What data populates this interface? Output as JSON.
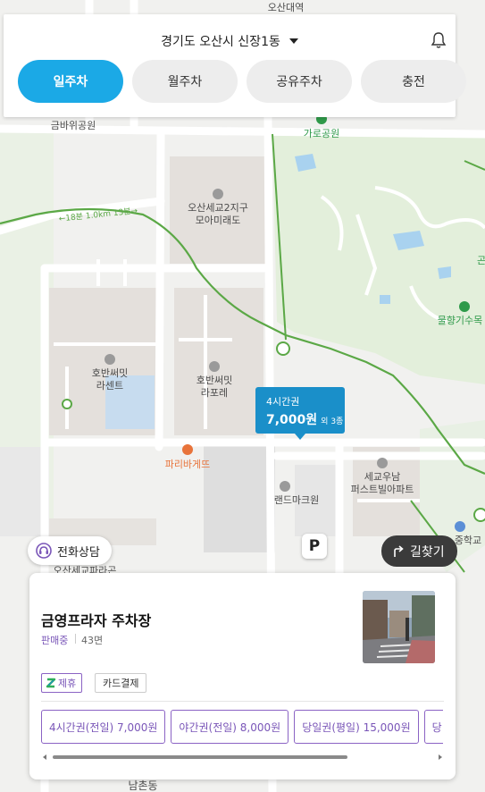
{
  "header": {
    "location": "경기도 오산시 신장1동",
    "tabs": [
      {
        "label": "일주차",
        "active": true
      },
      {
        "label": "월주차",
        "active": false
      },
      {
        "label": "공유주차",
        "active": false
      },
      {
        "label": "충전",
        "active": false
      }
    ]
  },
  "map": {
    "labels": {
      "osan_station": "오산대역",
      "geumbawi_park": "금바위공원",
      "garo_park": "가로공원",
      "walk_route": "←18분 1.0km 13분→",
      "apt1": "오산세교2지구\n모아미래도",
      "apt2": "호반써밋\n라센트",
      "apt3": "호반써밋\n라포레",
      "paris": "파리바게뜨",
      "landmark": "랜드마크원",
      "apt4": "세교우남\n퍼스트빌아파트",
      "arboretum": "물향기수목",
      "school": "중학교",
      "bottom1": "오산세교파라곤",
      "bottom2": "남촌동",
      "edge": "곤"
    },
    "marker": {
      "duration": "4시간권",
      "price": "7,000원",
      "extra": "외 3종"
    },
    "parking_letter": "P"
  },
  "buttons": {
    "call": "전화상담",
    "directions": "길찾기"
  },
  "lot": {
    "name": "금영프라자 주차장",
    "status": "판매중",
    "spaces": "43면",
    "tags": {
      "partner": "제휴",
      "card": "카드결제"
    },
    "tickets": [
      "4시간권(전일) 7,000원",
      "야간권(전일) 8,000원",
      "당일권(평일) 15,000원",
      "당"
    ]
  },
  "colors": {
    "accent": "#1ba9e6",
    "marker": "#1a8fc9",
    "purple": "#7a56b8",
    "park_green": "#e3efdb"
  },
  "icons": {
    "bell": "bell-icon",
    "caret": "chevron-down-icon",
    "call": "headset-icon",
    "directions": "turn-right-arrow-icon",
    "partner": "z-logo-icon"
  }
}
